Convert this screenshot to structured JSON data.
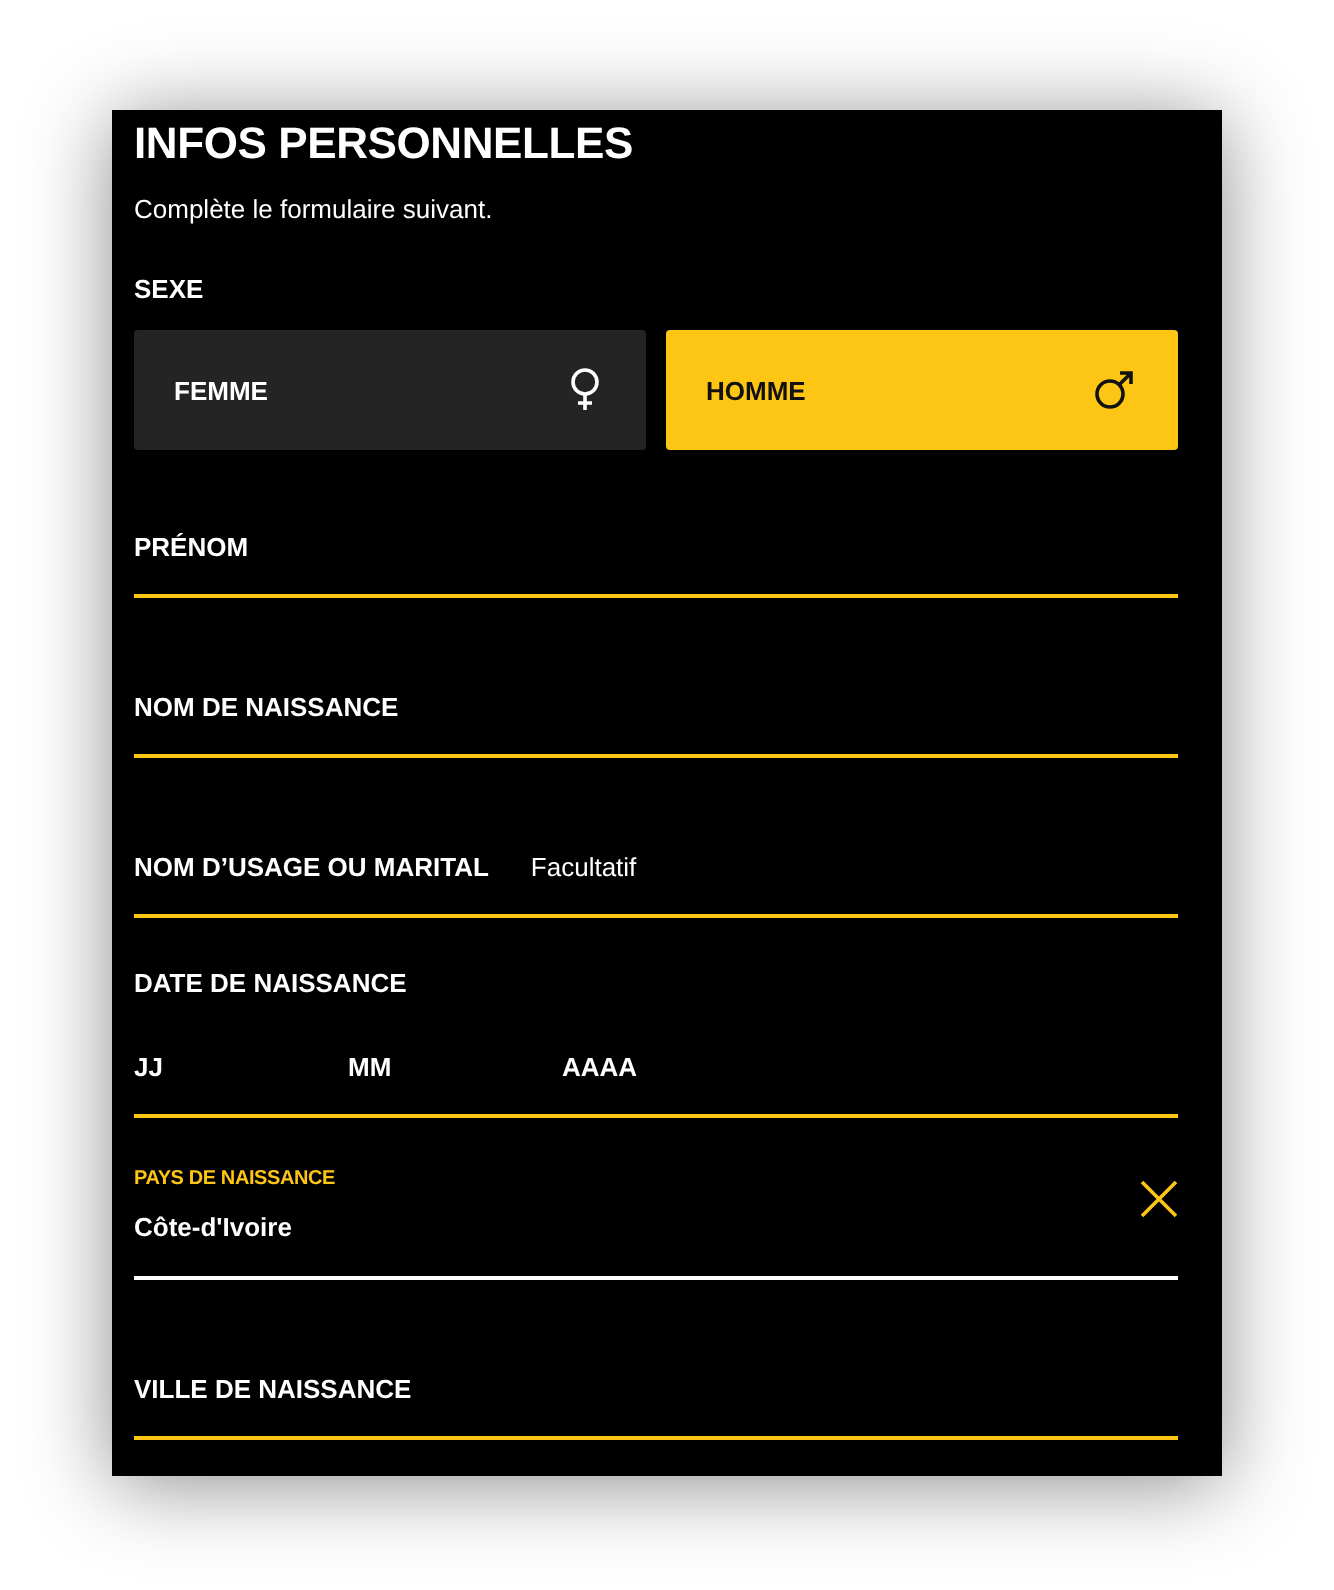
{
  "header": {
    "title": "INFOS PERSONNELLES",
    "subtitle": "Complète le formulaire suivant."
  },
  "sex": {
    "label": "SEXE",
    "options": [
      {
        "label": "FEMME",
        "kind": "female",
        "selected": false
      },
      {
        "label": "HOMME",
        "kind": "male",
        "selected": true
      }
    ]
  },
  "fields": [
    {
      "kind": "text",
      "label": "PRÉNOM"
    },
    {
      "kind": "text",
      "label": "NOM DE NAISSANCE"
    },
    {
      "kind": "text",
      "label": "NOM D’USAGE OU MARITAL",
      "note": "Facultatif"
    },
    {
      "kind": "date",
      "label": "DATE DE NAISSANCE",
      "parts": [
        {
          "placeholder": "JJ"
        },
        {
          "placeholder": "MM"
        },
        {
          "placeholder": "AAAA"
        }
      ]
    },
    {
      "kind": "select",
      "label": "PAYS DE NAISSANCE",
      "value": "Côte-d'Ivoire"
    },
    {
      "kind": "text",
      "label": "VILLE DE NAISSANCE"
    }
  ]
}
